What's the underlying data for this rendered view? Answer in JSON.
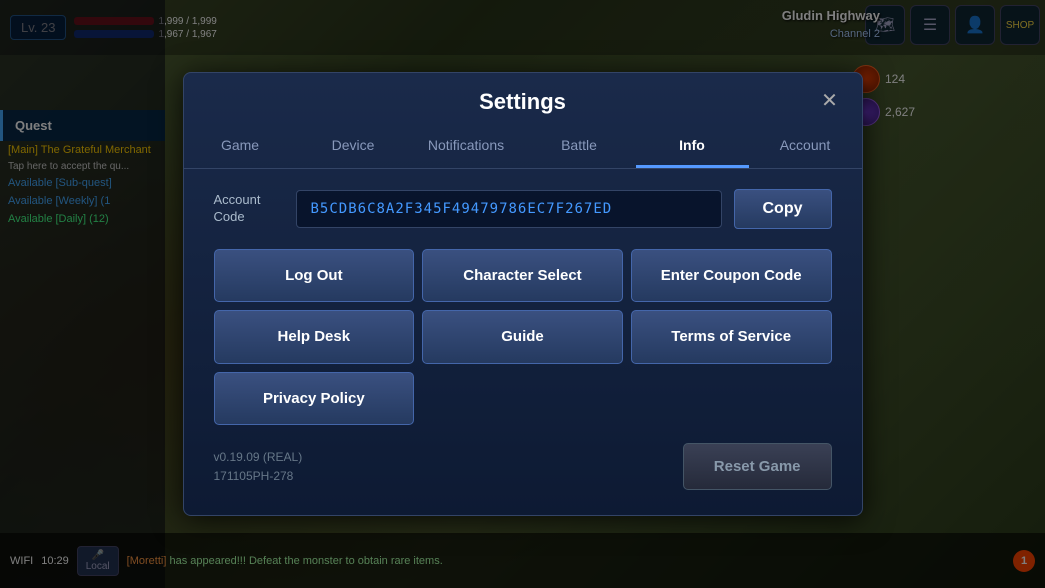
{
  "game": {
    "location": "Gludin Highway",
    "channel": "Channel 2",
    "player": {
      "level": "Lv. 23",
      "hp": "1,999 / 1,999",
      "mp": "1,967 / 1,967"
    },
    "resources": {
      "resource1": "124",
      "resource2": "2,627"
    },
    "bottom": {
      "wifi": "WIFI",
      "time": "10:29",
      "chat1": "[Moretti] has appeared!!! Defeat the monster to obtain rare items.",
      "chat1_name": "[Moretti]",
      "local": "Local",
      "badge": "1"
    }
  },
  "sidebar": {
    "quest_label": "Quest",
    "quest_items": [
      {
        "text": "[Main] The Grateful Merchant",
        "color": "yellow"
      },
      {
        "text": "Tap here to accept the qu...",
        "color": "white"
      },
      {
        "text": "Available [Sub-quest]",
        "color": "blue"
      },
      {
        "text": "Available [Weekly] (1",
        "color": "blue"
      },
      {
        "text": "Available [Daily] (12)",
        "color": "green"
      }
    ]
  },
  "modal": {
    "title": "Settings",
    "close_label": "✕",
    "tabs": [
      {
        "label": "Game",
        "active": false
      },
      {
        "label": "Device",
        "active": false
      },
      {
        "label": "Notifications",
        "active": false
      },
      {
        "label": "Battle",
        "active": false
      },
      {
        "label": "Info",
        "active": true
      },
      {
        "label": "Account",
        "active": false
      }
    ],
    "account_code_label": "Account Code",
    "account_code_value": "B5CDB6C8A2F345F49479786EC7F267ED",
    "copy_button": "Copy",
    "buttons": [
      {
        "label": "Log Out",
        "key": "log-out"
      },
      {
        "label": "Character Select",
        "key": "character-select"
      },
      {
        "label": "Enter Coupon Code",
        "key": "enter-coupon-code"
      },
      {
        "label": "Help Desk",
        "key": "help-desk"
      },
      {
        "label": "Guide",
        "key": "guide"
      },
      {
        "label": "Terms of Service",
        "key": "terms-of-service"
      },
      {
        "label": "Privacy Policy",
        "key": "privacy-policy"
      }
    ],
    "version_line1": "v0.19.09 (REAL)",
    "version_line2": "171105PH-278",
    "reset_button": "Reset Game"
  }
}
